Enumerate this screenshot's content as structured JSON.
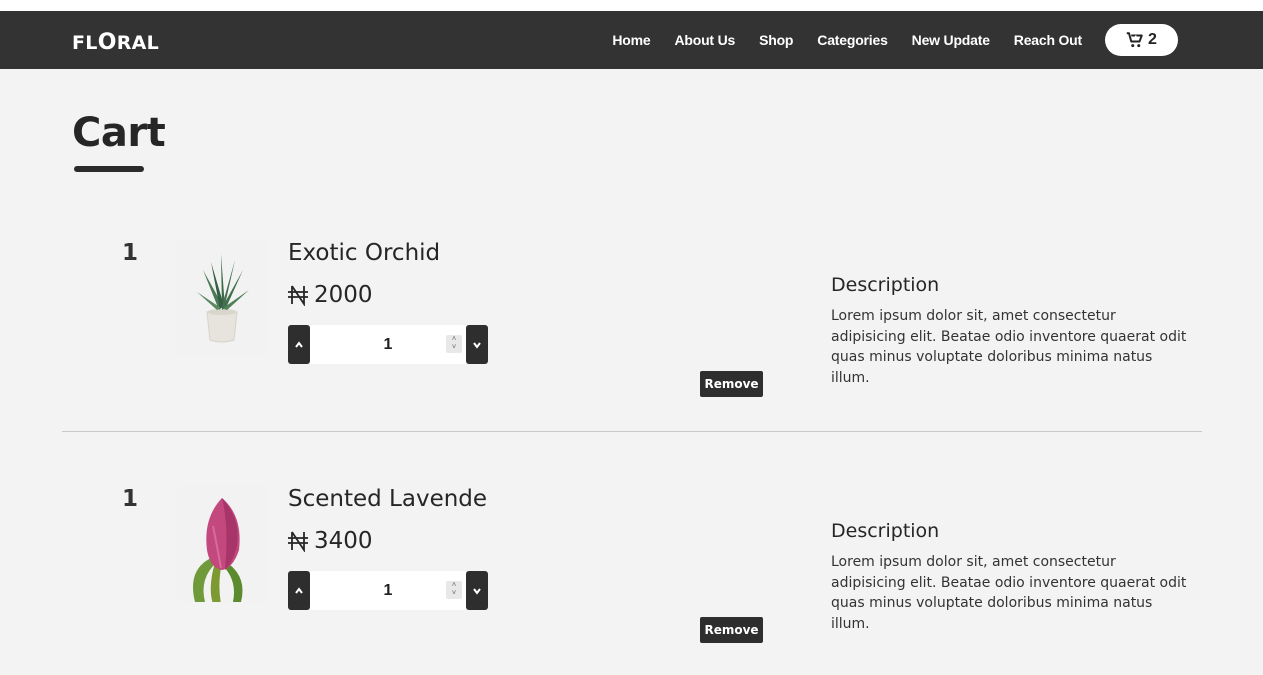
{
  "brand": {
    "logo_text_a": "F",
    "logo_text_b": "L",
    "logo_text_c": "O",
    "logo_text_d": "RAL"
  },
  "nav": {
    "items": [
      {
        "label": "Home"
      },
      {
        "label": "About Us"
      },
      {
        "label": "Shop"
      },
      {
        "label": "Categories"
      },
      {
        "label": "New Update"
      },
      {
        "label": "Reach Out"
      }
    ],
    "cart_count": "2",
    "cart_icon": "cart-plus-icon"
  },
  "page": {
    "title": "Cart"
  },
  "cart": {
    "currency_icon": "naira-icon",
    "items": [
      {
        "index": "1",
        "name": "Exotic Orchid",
        "price": "2000",
        "quantity": "1",
        "remove_label": "Remove",
        "description_title": "Description",
        "description": "Lorem ipsum dolor sit, amet consectetur adipisicing elit. Beatae odio inventore quaerat odit quas minus voluptate doloribus minima natus illum.",
        "image": "potted-succulent"
      },
      {
        "index": "1",
        "name": "Scented Lavende",
        "price": "3400",
        "quantity": "1",
        "remove_label": "Remove",
        "description_title": "Description",
        "description": "Lorem ipsum dolor sit, amet consectetur adipisicing elit. Beatae odio inventore quaerat odit quas minus voluptate doloribus minima natus illum.",
        "image": "pink-tulip"
      }
    ]
  },
  "colors": {
    "navbar": "#333333",
    "background": "#f3f3f3",
    "button": "#2e2e2e"
  }
}
